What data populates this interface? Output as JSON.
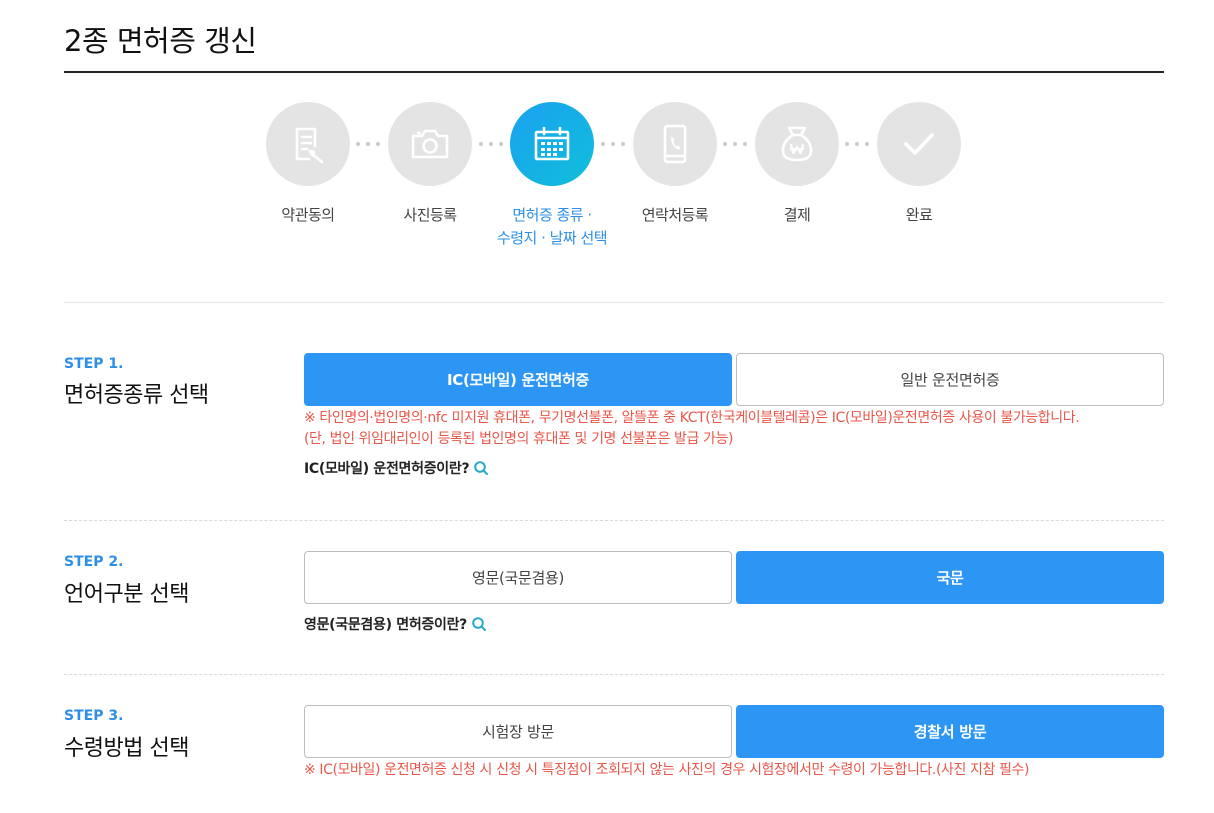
{
  "page": {
    "title": "2종 면허증 갱신"
  },
  "stepper": {
    "steps": [
      {
        "label_line1": "약관동의",
        "label_line2": "",
        "icon": "document-pen-icon",
        "active": false
      },
      {
        "label_line1": "사진등록",
        "label_line2": "",
        "icon": "camera-icon",
        "active": false
      },
      {
        "label_line1": "면허증 종류 ·",
        "label_line2": "수령지 · 날짜 선택",
        "icon": "calendar-icon",
        "active": true
      },
      {
        "label_line1": "연락처등록",
        "label_line2": "",
        "icon": "phone-icon",
        "active": false
      },
      {
        "label_line1": "결제",
        "label_line2": "",
        "icon": "money-bag-icon",
        "active": false
      },
      {
        "label_line1": "완료",
        "label_line2": "",
        "icon": "checkmark-icon",
        "active": false
      }
    ]
  },
  "step1": {
    "number": "STEP 1.",
    "heading": "면허증종류 선택",
    "options": [
      {
        "label": "IC(모바일) 운전면허증",
        "selected": true
      },
      {
        "label": "일반 운전면허증",
        "selected": false
      }
    ],
    "notice_line1": "※ 타인명의·법인명의·nfc 미지원 휴대폰, 무기명선불폰, 알뜰폰 중 KCT(한국케이블텔레콤)은 IC(모바일)운전면허증 사용이 불가능합니다.",
    "notice_line2": "(단, 법인 위임대리인이 등록된 법인명의 휴대폰 및 기명 선불폰은 발급 가능)",
    "info_link": "IC(모바일) 운전면허증이란?"
  },
  "step2": {
    "number": "STEP 2.",
    "heading": "언어구분 선택",
    "options": [
      {
        "label": "영문(국문겸용)",
        "selected": false
      },
      {
        "label": "국문",
        "selected": true
      }
    ],
    "info_link": "영문(국문겸용) 면허증이란?"
  },
  "step3": {
    "number": "STEP 3.",
    "heading": "수령방법 선택",
    "options": [
      {
        "label": "시험장 방문",
        "selected": false
      },
      {
        "label": "경찰서 방문",
        "selected": true
      }
    ],
    "notice": "※ IC(모바일) 운전면허증 신청 시 신청 시 특징점이 조회되지 않는 사진의 경우 시험장에서만 수령이 가능합니다.(사진 지참 필수)"
  },
  "colors": {
    "accent": "#2d96f5",
    "accent_text": "#2d8fe6",
    "notice": "#e8574a",
    "inactive_circle": "#e4e4e4"
  }
}
